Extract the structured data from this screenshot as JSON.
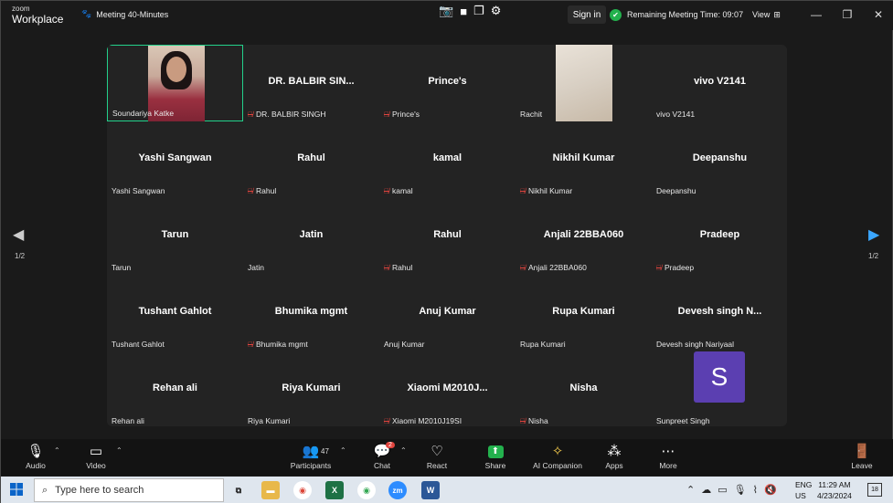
{
  "app": {
    "logo_line1": "zoom",
    "logo_line2": "Workplace"
  },
  "meeting": {
    "title": "Meeting 40-Minutes"
  },
  "header": {
    "sign_in": "Sign in",
    "remaining_label": "Remaining Meeting Time: 09:07",
    "view_label": "View"
  },
  "pagination": {
    "left": "1/2",
    "right": "1/2"
  },
  "tiles": [
    {
      "big": "",
      "caption": "Soundariya Katke",
      "muted": false,
      "kind": "video-girl",
      "active": true
    },
    {
      "big": "DR. BALBIR SIN...",
      "caption": "DR. BALBIR SINGH",
      "muted": true
    },
    {
      "big": "Prince's",
      "caption": "Prince's",
      "muted": true
    },
    {
      "big": "",
      "caption": "Rachit",
      "muted": false,
      "kind": "video-room"
    },
    {
      "big": "vivo V2141",
      "caption": "vivo V2141",
      "muted": false
    },
    {
      "big": "Yashi Sangwan",
      "caption": "Yashi Sangwan",
      "muted": false
    },
    {
      "big": "Rahul",
      "caption": "Rahul",
      "muted": true
    },
    {
      "big": "kamal",
      "caption": "kamal",
      "muted": true
    },
    {
      "big": "Nikhil Kumar",
      "caption": "Nikhil Kumar",
      "muted": true
    },
    {
      "big": "Deepanshu",
      "caption": "Deepanshu",
      "muted": false
    },
    {
      "big": "Tarun",
      "caption": "Tarun",
      "muted": false
    },
    {
      "big": "Jatin",
      "caption": "Jatin",
      "muted": false
    },
    {
      "big": "Rahul",
      "caption": "Rahul",
      "muted": true
    },
    {
      "big": "Anjali 22BBA060",
      "caption": "Anjali 22BBA060",
      "muted": true
    },
    {
      "big": "Pradeep",
      "caption": "Pradeep",
      "muted": true
    },
    {
      "big": "Tushant Gahlot",
      "caption": "Tushant Gahlot",
      "muted": false
    },
    {
      "big": "Bhumika mgmt",
      "caption": "Bhumika mgmt",
      "muted": true
    },
    {
      "big": "Anuj Kumar",
      "caption": "Anuj Kumar",
      "muted": false
    },
    {
      "big": "Rupa Kumari",
      "caption": "Rupa Kumari",
      "muted": false
    },
    {
      "big": "Devesh singh N...",
      "caption": "Devesh singh Nariyaal",
      "muted": false
    },
    {
      "big": "Rehan ali",
      "caption": "Rehan ali",
      "muted": false
    },
    {
      "big": "Riya Kumari",
      "caption": "Riya Kumari",
      "muted": false
    },
    {
      "big": "Xiaomi M2010J...",
      "caption": "Xiaomi M2010J19SI",
      "muted": true
    },
    {
      "big": "Nisha",
      "caption": "Nisha",
      "muted": true
    },
    {
      "big": "",
      "caption": "Sunpreet Singh",
      "muted": false,
      "kind": "avatar",
      "avatar_letter": "S"
    }
  ],
  "toolbar": {
    "audio": "Audio",
    "video": "Video",
    "participants": "Participants",
    "participants_count": "47",
    "chat": "Chat",
    "chat_badge": "2",
    "react": "React",
    "share": "Share",
    "ai_companion": "AI Companion",
    "apps": "Apps",
    "more": "More",
    "leave": "Leave"
  },
  "taskbar": {
    "search_placeholder": "Type here to search",
    "lang_line1": "ENG",
    "lang_line2": "US",
    "time": "11:29 AM",
    "date": "4/23/2024",
    "notifications": "18"
  },
  "colors": {
    "active_border": "#23d18b",
    "share_green": "#23b14d",
    "muted_red": "#e0443e",
    "avatar_purple": "#5b3fb1",
    "nav_blue": "#3aa6ff"
  }
}
